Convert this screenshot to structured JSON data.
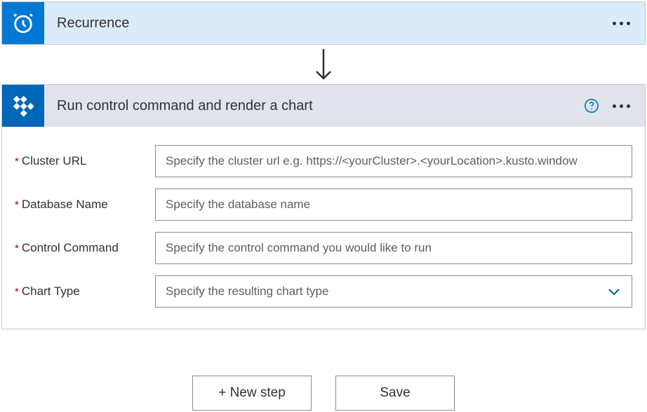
{
  "recurrence": {
    "title": "Recurrence"
  },
  "action": {
    "title": "Run control command and render a chart",
    "fields": {
      "clusterUrl": {
        "label": "Cluster URL",
        "placeholder": "Specify the cluster url e.g. https://<yourCluster>.<yourLocation>.kusto.window"
      },
      "databaseName": {
        "label": "Database Name",
        "placeholder": "Specify the database name"
      },
      "controlCmd": {
        "label": "Control Command",
        "placeholder": "Specify the control command you would like to run"
      },
      "chartType": {
        "label": "Chart Type",
        "placeholder": "Specify the resulting chart type"
      }
    }
  },
  "buttons": {
    "newStep": "+ New step",
    "save": "Save"
  }
}
